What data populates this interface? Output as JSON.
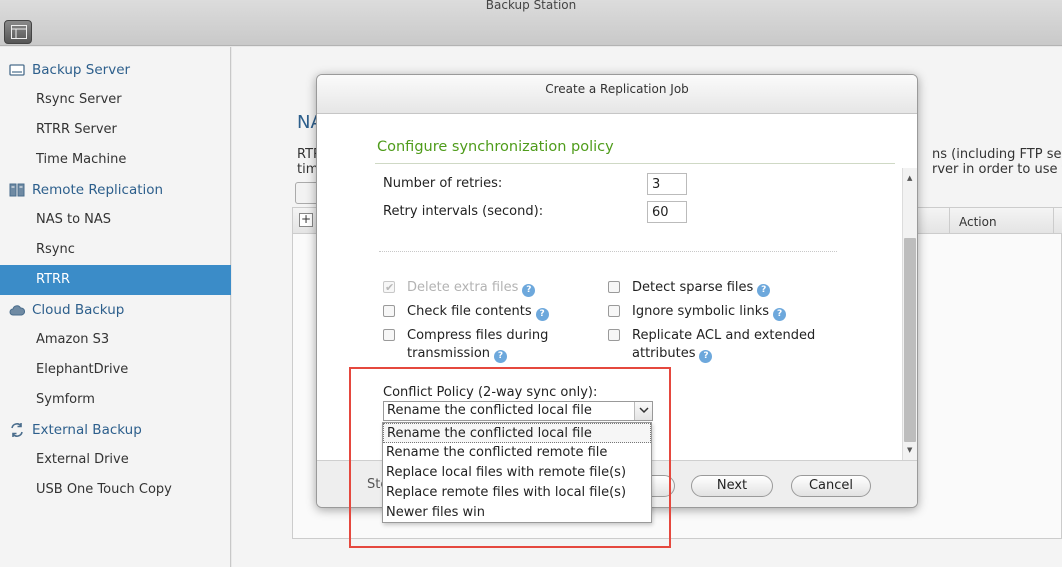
{
  "app": {
    "title": "Backup Station"
  },
  "sidebar": {
    "sections": [
      {
        "label": "Backup Server",
        "icon": "server-icon",
        "items": [
          {
            "label": "Rsync Server"
          },
          {
            "label": "RTRR Server"
          },
          {
            "label": "Time Machine"
          }
        ]
      },
      {
        "label": "Remote Replication",
        "icon": "replication-icon",
        "items": [
          {
            "label": "NAS to NAS"
          },
          {
            "label": "Rsync"
          },
          {
            "label": "RTRR",
            "active": true
          }
        ]
      },
      {
        "label": "Cloud Backup",
        "icon": "cloud-icon",
        "items": [
          {
            "label": "Amazon S3"
          },
          {
            "label": "ElephantDrive"
          },
          {
            "label": "Symform"
          }
        ]
      },
      {
        "label": "External Backup",
        "icon": "sync-arrows-icon",
        "items": [
          {
            "label": "External Drive"
          },
          {
            "label": "USB One Touch Copy"
          }
        ]
      }
    ]
  },
  "background_page": {
    "heading_fragment": "NA",
    "text_left_1": "RTR",
    "text_left_2": "tim",
    "text_right_1": "ns (including FTP server",
    "text_right_2": "rver in order to use this",
    "table_column_action": "Action"
  },
  "dialog": {
    "title": "Create a Replication Job",
    "section_title": "Configure synchronization policy",
    "retries": {
      "label": "Number of retries:",
      "value": "3"
    },
    "retry_interval": {
      "label": "Retry intervals (second):",
      "value": "60"
    },
    "options": [
      {
        "label": "Delete extra files",
        "checked": true,
        "disabled": true,
        "help": true
      },
      {
        "label": "Detect sparse files",
        "checked": false,
        "disabled": false,
        "help": true
      },
      {
        "label": "Check file contents",
        "checked": false,
        "disabled": false,
        "help": true
      },
      {
        "label": "Ignore symbolic links",
        "checked": false,
        "disabled": false,
        "help": true
      },
      {
        "label": "Compress files during",
        "label2": "transmission",
        "checked": false,
        "disabled": false,
        "help": true
      },
      {
        "label": "Replicate ACL and extended",
        "label2": "attributes",
        "checked": false,
        "disabled": false,
        "help": true
      }
    ],
    "conflict_policy": {
      "label": "Conflict Policy (2-way sync only):",
      "selected": "Rename the conflicted local file",
      "options": [
        "Rename the conflicted local file",
        "Rename the conflicted remote file",
        "Replace local files with remote file(s)",
        "Replace remote files with local file(s)",
        "Newer files win"
      ]
    },
    "footer": {
      "step_text": "Ste",
      "next_label": "Next",
      "cancel_label": "Cancel"
    }
  },
  "colors": {
    "accent_green": "#4f9c1b",
    "selection_blue": "#3b8cc8",
    "highlight_red": "#e5483e",
    "heading_blue": "#2d5f8c"
  }
}
